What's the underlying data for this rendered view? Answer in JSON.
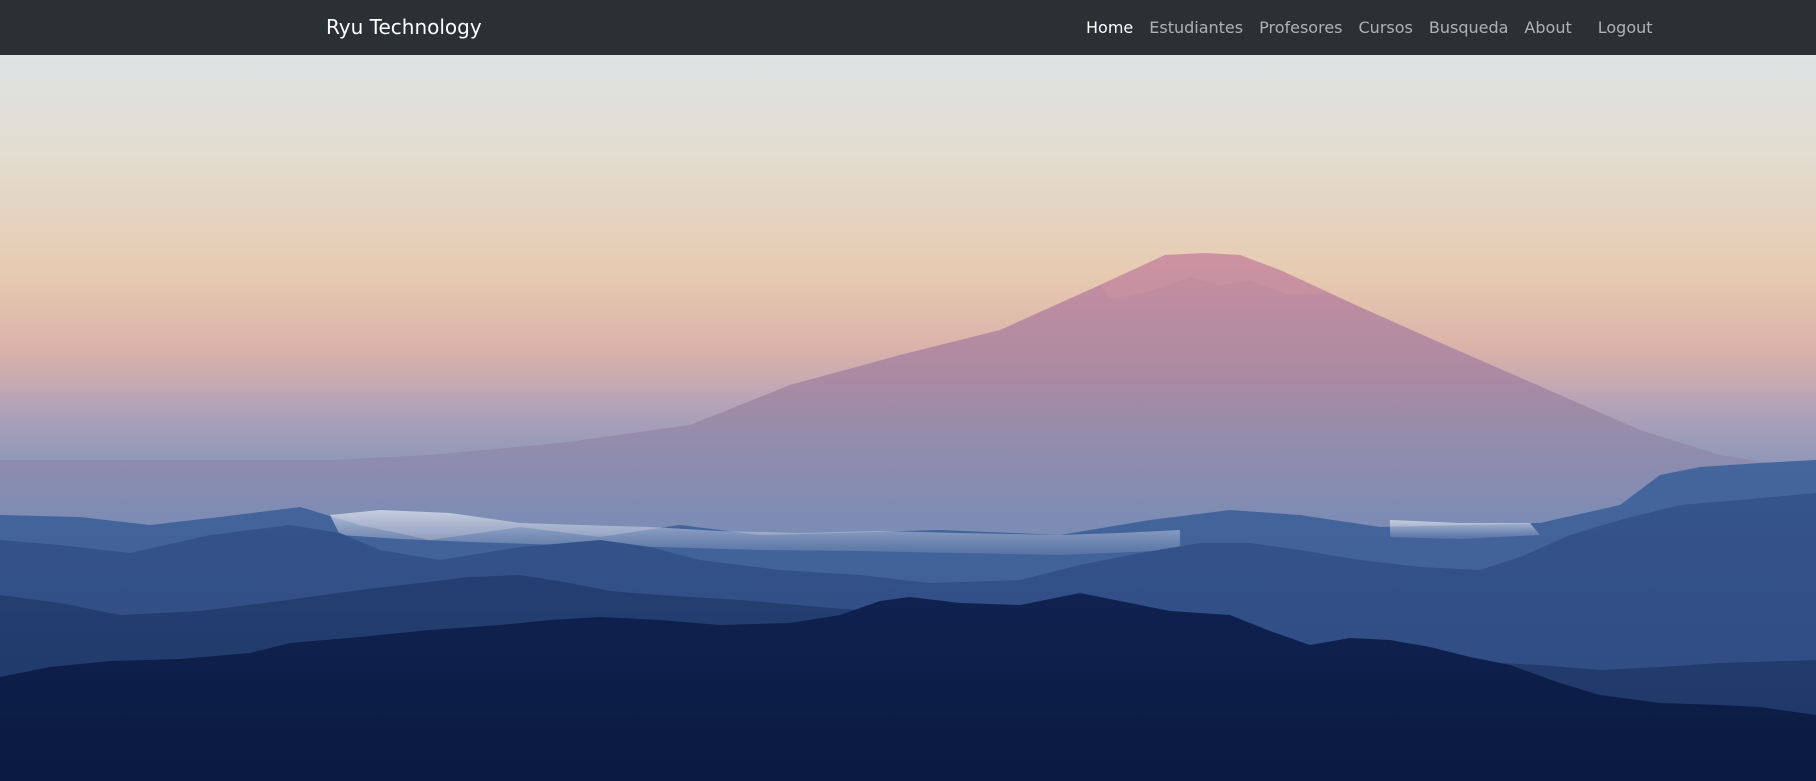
{
  "navbar": {
    "brand": "Ryu Technology",
    "items": [
      {
        "label": "Home",
        "active": true
      },
      {
        "label": "Estudiantes",
        "active": false
      },
      {
        "label": "Profesores",
        "active": false
      },
      {
        "label": "Cursos",
        "active": false
      },
      {
        "label": "Busqueda",
        "active": false
      },
      {
        "label": "About",
        "active": false
      }
    ],
    "logout": "Logout"
  },
  "colors": {
    "navbar_bg": "#2b3035",
    "link_active": "#ffffff",
    "link_muted": "rgba(255,255,255,0.62)"
  },
  "hero": {
    "icon": "mountain-landscape-image"
  }
}
